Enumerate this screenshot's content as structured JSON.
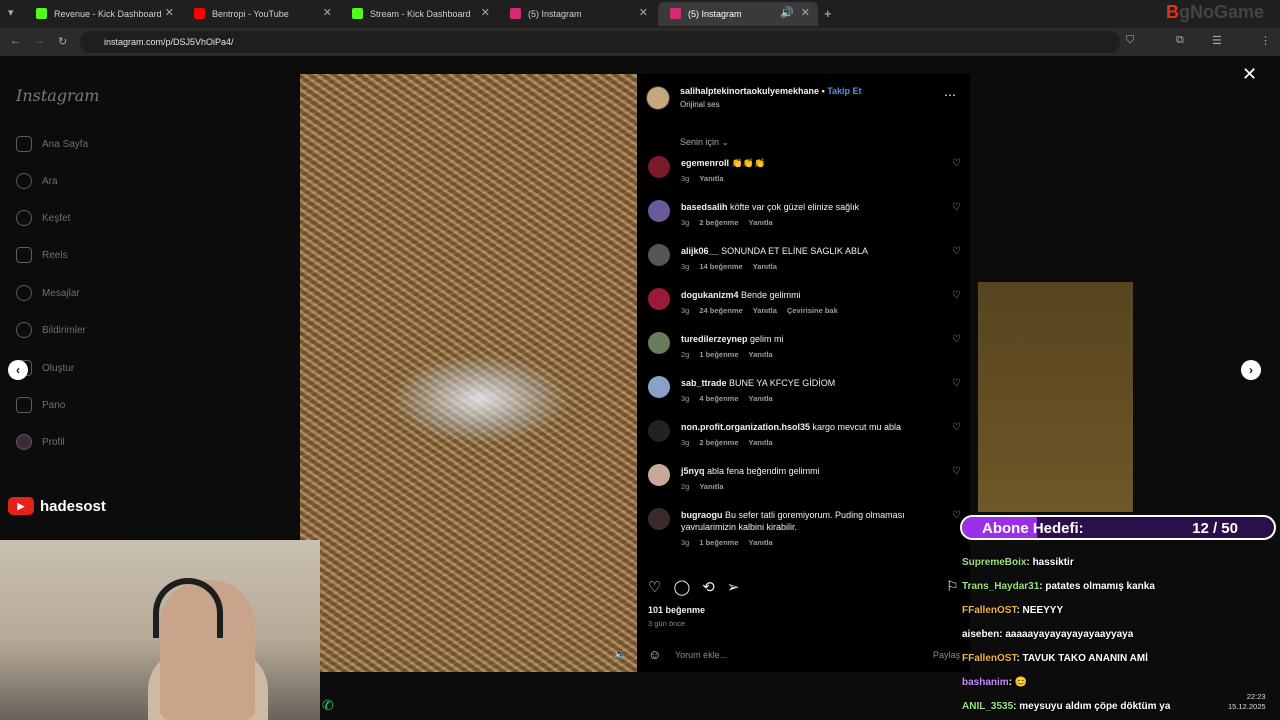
{
  "browser": {
    "tabs": [
      {
        "label": "Revenue - Kick Dashboard",
        "color": "#53fc18"
      },
      {
        "label": "Bentropi - YouTube",
        "color": "#ff0000"
      },
      {
        "label": "Stream - Kick Dashboard",
        "color": "#53fc18"
      },
      {
        "label": "(5) Instagram",
        "color": "#d62976"
      },
      {
        "label": "(5) Instagram",
        "color": "#d62976",
        "active": true
      }
    ],
    "url": "instagram.com/p/DSJ5VhOiPa4/"
  },
  "sidebar": {
    "logo": "Instagram",
    "items": [
      {
        "label": "Ana Sayfa",
        "icon": "home-icon"
      },
      {
        "label": "Ara",
        "icon": "search-icon"
      },
      {
        "label": "Keşfet",
        "icon": "compass-icon"
      },
      {
        "label": "Reels",
        "icon": "reels-icon"
      },
      {
        "label": "Mesajlar",
        "icon": "messenger-icon"
      },
      {
        "label": "Bildirimler",
        "icon": "heart-icon"
      },
      {
        "label": "Oluştur",
        "icon": "plus-icon"
      },
      {
        "label": "Pano",
        "icon": "chart-icon"
      },
      {
        "label": "Profil",
        "icon": "profile-icon"
      }
    ]
  },
  "post": {
    "username": "salihalptekinortaokulyemekhane",
    "follow": "Takip Et",
    "audio": "Orijinal ses",
    "sort": "Senin için",
    "likes": "101 beğenme",
    "ago": "3 gün önce",
    "comment_placeholder": "Yorum ekle...",
    "share": "Paylaş"
  },
  "comments": [
    {
      "user": "egemenroll",
      "text": "👏👏👏",
      "age": "3g",
      "likes": "",
      "reply": "Yanıtla",
      "extra": ""
    },
    {
      "user": "basedsalih",
      "text": "köfte var çok güzel elinize sağlık",
      "age": "3g",
      "likes": "2 beğenme",
      "reply": "Yanıtla",
      "extra": ""
    },
    {
      "user": "alijk06__",
      "text": "SONUNDA ET ELİNE SAGLIK ABLA",
      "age": "3g",
      "likes": "14 beğenme",
      "reply": "Yanıtla",
      "extra": ""
    },
    {
      "user": "dogukanizm4",
      "text": "Bende gelimmi",
      "age": "3g",
      "likes": "24 beğenme",
      "reply": "Yanıtla",
      "extra": "Çevirisine bak"
    },
    {
      "user": "turedilerzeynep",
      "text": "gelim mi",
      "age": "2g",
      "likes": "1 beğenme",
      "reply": "Yanıtla",
      "extra": ""
    },
    {
      "user": "sab_ttrade",
      "text": "BUNE YA KFCYE GİDİOM",
      "age": "3g",
      "likes": "4 beğenme",
      "reply": "Yanıtla",
      "extra": ""
    },
    {
      "user": "non.profit.organization.hsol35",
      "text": "kargo mevcut mu abla",
      "age": "3g",
      "likes": "2 beğenme",
      "reply": "Yanıtla",
      "extra": ""
    },
    {
      "user": "j5nyq",
      "text": "abla fena beğendim gelimmi",
      "age": "2g",
      "likes": "",
      "reply": "Yanıtla",
      "extra": ""
    },
    {
      "user": "bugraogu",
      "text": "Bu sefer tatli goremiyorum. Puding olmaması yavrularimizin kalbini kirabilir.",
      "age": "3g",
      "likes": "1 beğenme",
      "reply": "Yanıtla",
      "extra": ""
    }
  ],
  "overlay": {
    "youtube_name": "hadesost",
    "goal_label": "Abone Hedefi:",
    "goal_count": "12 / 50",
    "goal_progress": 0.24,
    "brand_prefix": "B",
    "brand_rest": "gNoGame",
    "clock_time": "22:23",
    "clock_date": "15.12.2025",
    "chat": [
      {
        "user": "SupremeBoix",
        "msg": "hassiktir",
        "color": "#9be37b"
      },
      {
        "user": "Trans_Haydar31",
        "msg": "patates olmamış kanka",
        "color": "#9be37b"
      },
      {
        "user": "FFallenOST",
        "msg": "NEEYYY",
        "color": "#f0b24a"
      },
      {
        "user": "aiseben",
        "msg": "aaaaayayayayayayaayyaya",
        "color": "#ffffff"
      },
      {
        "user": "FFallenOST",
        "msg": "TAVUK TAKO ANANIN AMİ",
        "color": "#f0b24a"
      },
      {
        "user": "bashanim",
        "msg": "😊",
        "color": "#c98bff"
      },
      {
        "user": "ANIL_3535",
        "msg": "meysuyu aldım çöpe döktüm ya",
        "color": "#9be37b"
      }
    ]
  }
}
